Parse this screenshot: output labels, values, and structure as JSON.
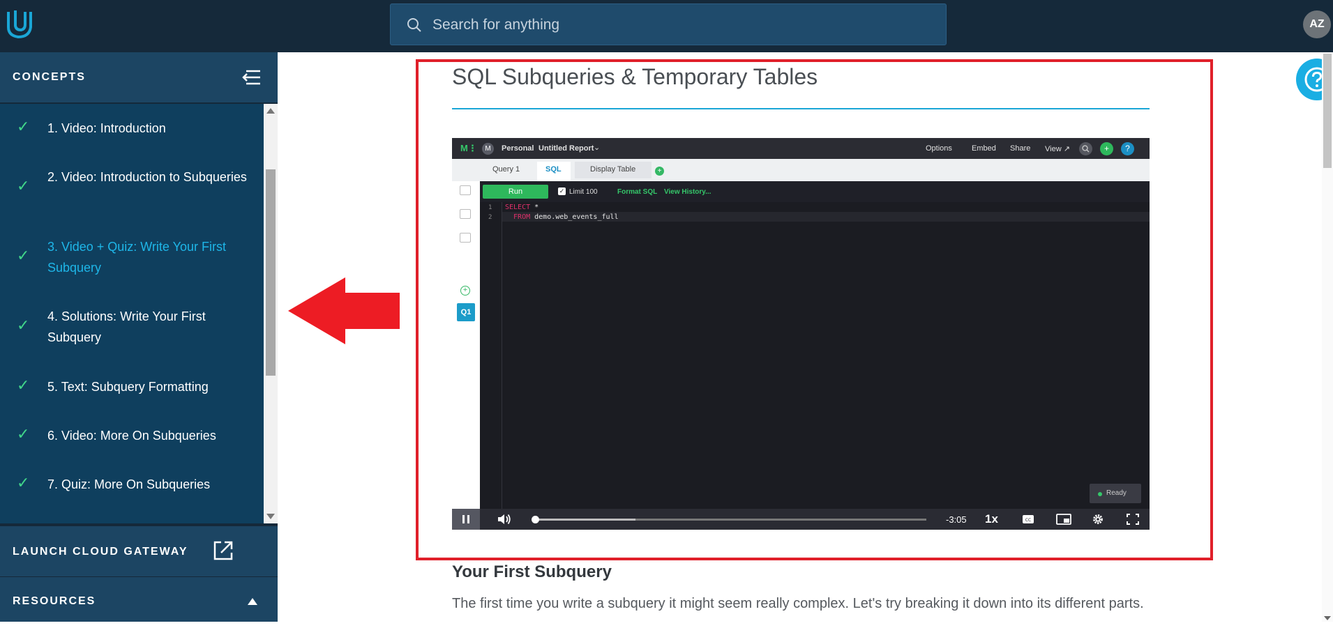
{
  "header": {
    "search_placeholder": "Search for anything",
    "avatar_initials": "AZ"
  },
  "sidebar": {
    "concepts_title": "CONCEPTS",
    "items": [
      {
        "label": "1. Video: Introduction",
        "completed": true
      },
      {
        "label": "2. Video: Introduction to Subqueries",
        "completed": true
      },
      {
        "label": "3. Video + Quiz: Write Your First Subquery",
        "completed": true,
        "active": true
      },
      {
        "label": "4. Solutions: Write Your First Subquery",
        "completed": true
      },
      {
        "label": "5. Text: Subquery Formatting",
        "completed": true
      },
      {
        "label": "6. Video: More On Subqueries",
        "completed": true
      },
      {
        "label": "7. Quiz: More On Subqueries",
        "completed": true
      }
    ],
    "check_glyph": "✓",
    "launch_label": "LAUNCH CLOUD GATEWAY",
    "resources_label": "RESOURCES"
  },
  "main": {
    "page_title": "SQL Subqueries & Temporary Tables",
    "section_heading": "Your First Subquery",
    "section_text": "The first time you write a subquery it might seem really complex. Let's try breaking it down into its different parts."
  },
  "video": {
    "brand": "M⋮",
    "personal_icon": "M",
    "workspace": "Personal",
    "report_title": "Untitled Report",
    "report_caret": "⌄",
    "menu": [
      "Options",
      "Embed",
      "Share",
      "View ↗"
    ],
    "add_glyph": "+",
    "help_glyph": "?",
    "tabs": {
      "query": "Query 1",
      "sql": "SQL",
      "display": "Display Table"
    },
    "run_label": "Run",
    "limit_checked_glyph": "✓",
    "limit_label": "Limit 100",
    "format_label": "Format SQL",
    "history_label": "View History...",
    "q1_label": "Q1",
    "code_lines": [
      {
        "num": "1",
        "keyword": "SELECT",
        "rest": " *"
      },
      {
        "num": "2",
        "keyword": "  FROM",
        "rest": " demo.web_events_full"
      }
    ],
    "ready_label": "Ready",
    "time_remaining": "-3:05",
    "speed": "1x",
    "progress_fraction": 0.0,
    "buffered_fraction": 0.26
  },
  "colors": {
    "topbar": "#15293a",
    "accent": "#1aaee3",
    "check": "#41d68a",
    "highlight_border": "#e0202a",
    "arrow": "#ed1c24"
  }
}
